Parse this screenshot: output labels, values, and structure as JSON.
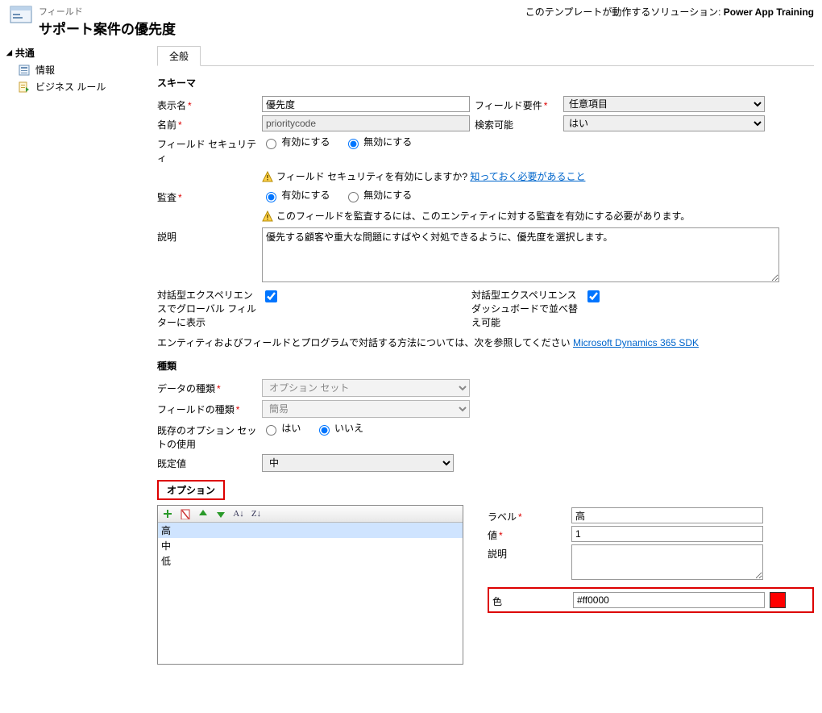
{
  "header": {
    "subtitle": "フィールド",
    "title": "サポート案件の優先度",
    "solution_prefix": "このテンプレートが動作するソリューション: ",
    "solution_name": "Power App Training"
  },
  "sidebar": {
    "group": "共通",
    "items": [
      "情報",
      "ビジネス ルール"
    ]
  },
  "tab": "全般",
  "schema": {
    "heading": "スキーマ",
    "display_name_lab": "表示名",
    "display_name": "優先度",
    "field_req_lab": "フィールド要件",
    "field_req_value": "任意項目",
    "name_lab": "名前",
    "name": "prioritycode",
    "searchable_lab": "検索可能",
    "searchable_value": "はい",
    "security_lab": "フィールド セキュリティ",
    "enable": "有効にする",
    "disable": "無効にする",
    "security_warn": "フィールド セキュリティを有効にしますか?",
    "security_link": "知っておく必要があること",
    "audit_lab": "監査",
    "audit_warn": "このフィールドを監査するには、このエンティティに対する監査を有効にする必要があります。",
    "desc_lab": "説明",
    "desc": "優先する顧客や重大な問題にすばやく対処できるように、優先度を選択します。",
    "interactive_global_lab": "対話型エクスペリエンスでグローバル フィルターに表示",
    "interactive_dash_lab": "対話型エクスペリエンス ダッシュボードで並べ替え可能",
    "sdk_text": "エンティティおよびフィールドとプログラムで対話する方法については、次を参照してください",
    "sdk_link": "Microsoft Dynamics 365 SDK"
  },
  "type": {
    "heading": "種類",
    "data_type_lab": "データの種類",
    "data_type": "オプション セット",
    "field_type_lab": "フィールドの種類",
    "field_type": "簡易",
    "existing_lab": "既存のオプション セットの使用",
    "yes": "はい",
    "no": "いいえ",
    "default_lab": "既定値",
    "default": "中"
  },
  "options": {
    "heading": "オプション",
    "items": [
      "高",
      "中",
      "低"
    ],
    "label_lab": "ラベル",
    "label": "高",
    "value_lab": "値",
    "value": "1",
    "desc_lab": "説明",
    "desc": "",
    "color_lab": "色",
    "color": "#ff0000"
  }
}
